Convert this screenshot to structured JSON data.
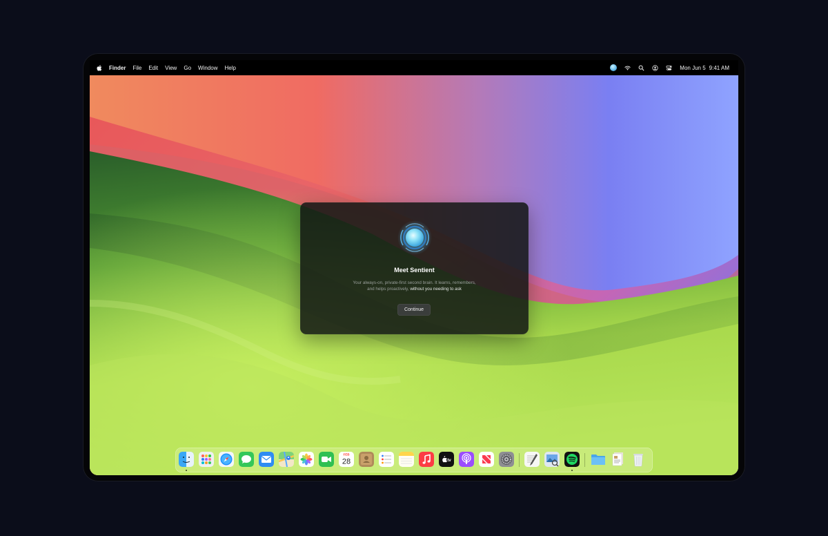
{
  "menubar": {
    "app_name": "Finder",
    "menus": [
      "File",
      "Edit",
      "View",
      "Go",
      "Window",
      "Help"
    ],
    "status_icons": [
      "sentient-orb-icon",
      "wifi-icon",
      "search-icon",
      "user-icon",
      "control-center-icon"
    ],
    "date": "Mon Jun 5",
    "time": "9:41 AM"
  },
  "dialog": {
    "title": "Meet Sentient",
    "body_line1": "Your always-on, private-first second brain. It learns, remembers,",
    "body_line2_prefix": "and helps proactively,",
    "body_line2_highlight": "without you needing to ask",
    "continue_label": "Continue"
  },
  "dock": {
    "calendar": {
      "month": "FEB",
      "day": "28"
    },
    "apps": [
      "Finder",
      "Launchpad",
      "Safari",
      "Messages",
      "Mail",
      "Maps",
      "Photos",
      "FaceTime",
      "Calendar",
      "Contacts",
      "Reminders",
      "Notes",
      "Music",
      "TV",
      "Podcasts",
      "News",
      "System Settings",
      "TextEdit",
      "Preview",
      "Spotify",
      "Downloads",
      "Documents",
      "Trash"
    ],
    "tv_label": "tv",
    "running": [
      "Finder",
      "Spotify"
    ]
  },
  "colors": {
    "accent_orb": "#6fd3f5",
    "dialog_bg": "#121614",
    "menubar_bg": "#000000"
  }
}
